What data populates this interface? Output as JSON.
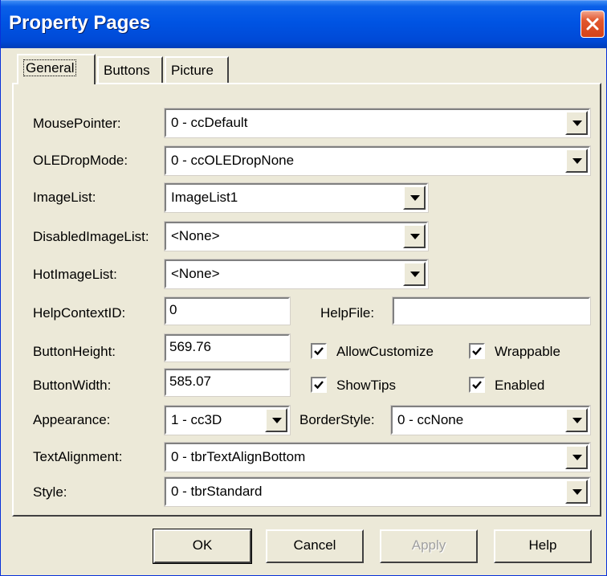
{
  "window": {
    "title": "Property Pages"
  },
  "tabs": [
    {
      "label": "General",
      "active": true
    },
    {
      "label": "Buttons",
      "active": false
    },
    {
      "label": "Picture",
      "active": false
    }
  ],
  "fields": {
    "mouse_pointer": {
      "label": "MousePointer:",
      "value": "0 - ccDefault"
    },
    "ole_drop_mode": {
      "label": "OLEDropMode:",
      "value": "0 - ccOLEDropNone"
    },
    "image_list": {
      "label": "ImageList:",
      "value": "ImageList1"
    },
    "disabled_image_list": {
      "label": "DisabledImageList:",
      "value": "<None>"
    },
    "hot_image_list": {
      "label": "HotImageList:",
      "value": "<None>"
    },
    "help_context_id": {
      "label": "HelpContextID:",
      "value": "0"
    },
    "help_file": {
      "label": "HelpFile:",
      "value": ""
    },
    "button_height": {
      "label": "ButtonHeight:",
      "value": "569.76"
    },
    "button_width": {
      "label": "ButtonWidth:",
      "value": "585.07"
    },
    "appearance": {
      "label": "Appearance:",
      "value": "1 - cc3D"
    },
    "border_style": {
      "label": "BorderStyle:",
      "value": "0 - ccNone"
    },
    "text_alignment": {
      "label": "TextAlignment:",
      "value": "0 - tbrTextAlignBottom"
    },
    "style": {
      "label": "Style:",
      "value": "0 - tbrStandard"
    }
  },
  "checkboxes": {
    "allow_customize": {
      "label": "AllowCustomize",
      "checked": true
    },
    "wrappable": {
      "label": "Wrappable",
      "checked": true
    },
    "show_tips": {
      "label": "ShowTips",
      "checked": true
    },
    "enabled": {
      "label": "Enabled",
      "checked": true
    }
  },
  "buttons": {
    "ok": "OK",
    "cancel": "Cancel",
    "apply": "Apply",
    "help": "Help"
  },
  "colors": {
    "title_bar": "#0054E3",
    "dialog_face": "#ECE9D8",
    "close_button": "#E2582F"
  }
}
